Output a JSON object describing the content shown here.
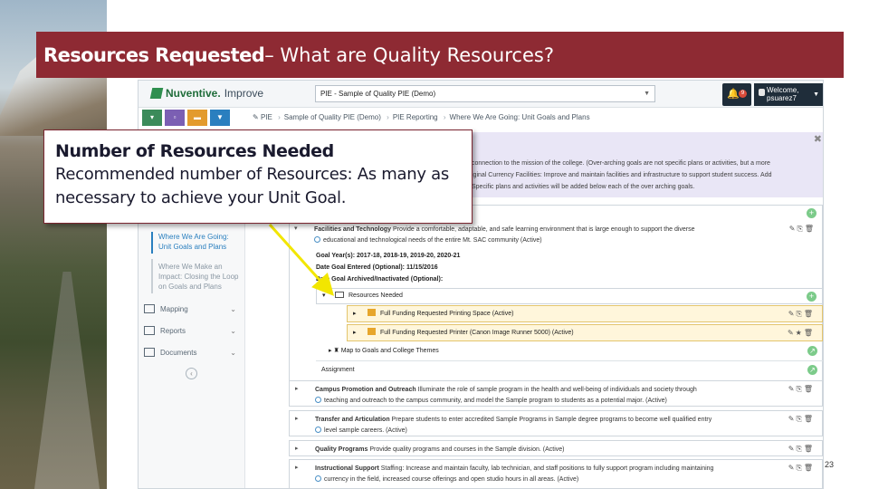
{
  "slide": {
    "title_bold": "Resources Requested",
    "title_rest": " – What are Quality Resources?",
    "page_number": "23"
  },
  "callout": {
    "heading": "Number of Resources Needed",
    "body": "Recommended number of Resources: As many as necessary to achieve your Unit Goal."
  },
  "app": {
    "logo_brand": "Nuventive.",
    "logo_product": "Improve",
    "plan_select": "PIE - Sample of Quality PIE (Demo)",
    "notification_count": "9",
    "welcome_line1": "Welcome,",
    "welcome_line2": "psuarez7",
    "breadcrumbs": [
      "PIE",
      "Sample of Quality PIE (Demo)",
      "PIE Reporting",
      "Where We Are Going: Unit Goals and Plans"
    ],
    "infobox_line1": "connection to the mission of the college. (Over-arching goals are not specific plans or activities, but a more",
    "infobox_line2": "iginal Currency   Facilities: Improve and maintain facilities and infrastructure to support student success.   Add",
    "infobox_line3": "Specific plans and activities will be added below each of the over arching goals.",
    "sidebar": {
      "active_link": "Where We Are Going: Unit Goals and Plans",
      "muted_link": "Where We Make an Impact: Closing the Loop on Goals and Plans",
      "items": [
        {
          "label": "Mapping"
        },
        {
          "label": "Reports"
        },
        {
          "label": "Documents"
        }
      ]
    },
    "goals": {
      "facilities_title": "Facilities and Technology",
      "facilities_text": "Provide a comfortable, adaptable, and safe learning environment that is large enough to support the diverse",
      "facilities_text2": "educational and technological needs of the entire Mt. SAC community (Active)",
      "goal_years": "Goal Year(s): 2017-18, 2018-19, 2019-20, 2020-21",
      "date_entered": "Date Goal Entered (Optional): 11/15/2016",
      "date_archived": "Date Goal Archived/Inactivated (Optional):",
      "resources_needed": "Resources Needed",
      "resource_items": [
        "Full Funding Requested Printing Space (Active)",
        "Full Funding Requested Printer (Canon Image Runner 5000) (Active)"
      ],
      "map_label": "Map to Goals and College Themes",
      "assignment_label": "Assignment",
      "other_goals": [
        {
          "title": "Campus Promotion and Outreach",
          "text": "Illuminate the role of sample program in the health and well-being of individuals and society through",
          "text2": "teaching and outreach to the campus community, and model the Sample program to students as a potential major. (Active)"
        },
        {
          "title": "Transfer and Articulation",
          "text": "Prepare students to enter accredited Sample Programs in Sample degree programs to become well qualified entry",
          "text2": "level sample careers. (Active)"
        },
        {
          "title": "Quality Programs",
          "text": "Provide quality programs and courses in the Sample division. (Active)",
          "text2": ""
        },
        {
          "title": "Instructional Support",
          "text": "Staffing: Increase and maintain faculty, lab technician, and staff positions to fully support program including maintaining",
          "text2": "currency in the field, increased course offerings and open studio hours in all areas. (Active)"
        }
      ]
    }
  },
  "colors": {
    "banner": "#8e2a33",
    "arrow": "#f2e600",
    "accent": "#2a7fbf"
  }
}
